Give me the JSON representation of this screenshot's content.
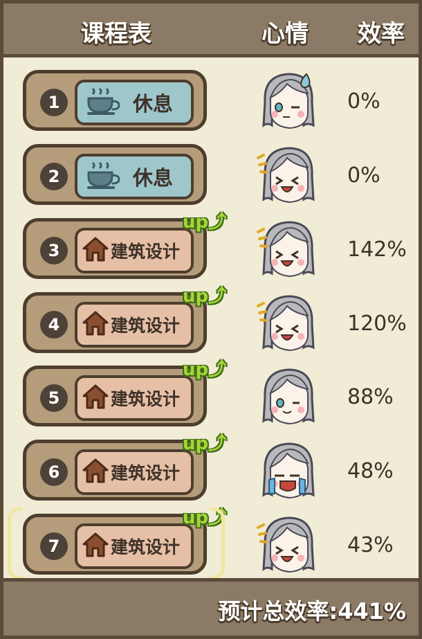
{
  "header": {
    "schedule": "课程表",
    "mood": "心情",
    "efficiency": "效率"
  },
  "rows": [
    {
      "num": "1",
      "activity": "休息",
      "kind": "rest",
      "up": "",
      "mood": "tired-sweat",
      "eff": "0%"
    },
    {
      "num": "2",
      "activity": "休息",
      "kind": "rest",
      "up": "",
      "mood": "happy",
      "eff": "0%"
    },
    {
      "num": "3",
      "activity": "建筑设计",
      "kind": "build",
      "up": "up",
      "mood": "happy",
      "eff": "142%"
    },
    {
      "num": "4",
      "activity": "建筑设计",
      "kind": "build",
      "up": "up",
      "mood": "happy",
      "eff": "120%"
    },
    {
      "num": "5",
      "activity": "建筑设计",
      "kind": "build",
      "up": "up",
      "mood": "content",
      "eff": "88%"
    },
    {
      "num": "6",
      "activity": "建筑设计",
      "kind": "build",
      "up": "up",
      "mood": "crying",
      "eff": "48%"
    },
    {
      "num": "7",
      "activity": "建筑设计",
      "kind": "build",
      "up": "up",
      "mood": "happy",
      "eff": "43%"
    }
  ],
  "footer": {
    "total": "预计总效率:441%"
  },
  "colors": {
    "header_bg": "#8a7a66",
    "border": "#5b4a37",
    "slot": "#b59d7c",
    "rest_tag": "#9ec7cc",
    "build_tag": "#e6c0a6",
    "up_green": "#a8d43a"
  },
  "icons": {
    "rest": "coffee-cup-icon",
    "build": "house-icon"
  }
}
